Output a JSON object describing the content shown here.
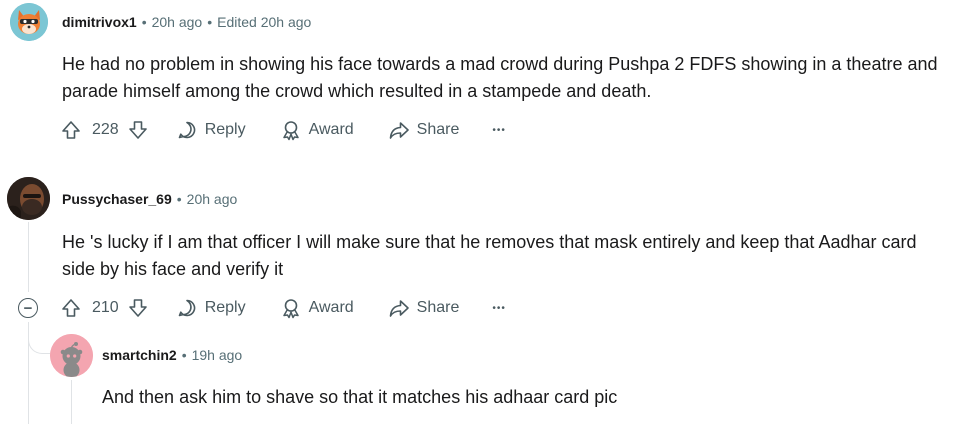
{
  "comments": [
    {
      "username": "dimitrivox1",
      "sep1": "•",
      "time": "20h ago",
      "sep2": "•",
      "edited": "Edited 20h ago",
      "text_line1": "He had no problem in showing his face towards a mad crowd during Pushpa 2 FDFS showing in a theatre and",
      "text_line2": "parade himself among the crowd which resulted in a stampede and death.",
      "votes": "228",
      "reply_label": "Reply",
      "award_label": "Award",
      "share_label": "Share",
      "more": "•••"
    },
    {
      "username": "Pussychaser_69",
      "sep1": "•",
      "time": "20h ago",
      "text_line1": "He 's lucky if I am that officer I will make sure that he removes that mask entirely and keep that Aadhar card",
      "text_line2": "side by his face and verify it",
      "votes": "210",
      "reply_label": "Reply",
      "award_label": "Award",
      "share_label": "Share",
      "more": "•••",
      "collapse_symbol": "−"
    },
    {
      "username": "smartchin2",
      "sep1": "•",
      "time": "19h ago",
      "text_line1": "And then ask him to shave so that it matches his adhaar card pic"
    }
  ],
  "colors": {
    "text": "#1a1a1b",
    "meta": "#576f76",
    "action": "#4a5a60",
    "thread_line": "#e0e3e6",
    "snoo_bg": "#f4a5b0"
  },
  "icons": [
    "upvote-icon",
    "downvote-icon",
    "reply-icon",
    "award-icon",
    "share-icon",
    "more-icon",
    "collapse-icon",
    "snoo-icon"
  ]
}
